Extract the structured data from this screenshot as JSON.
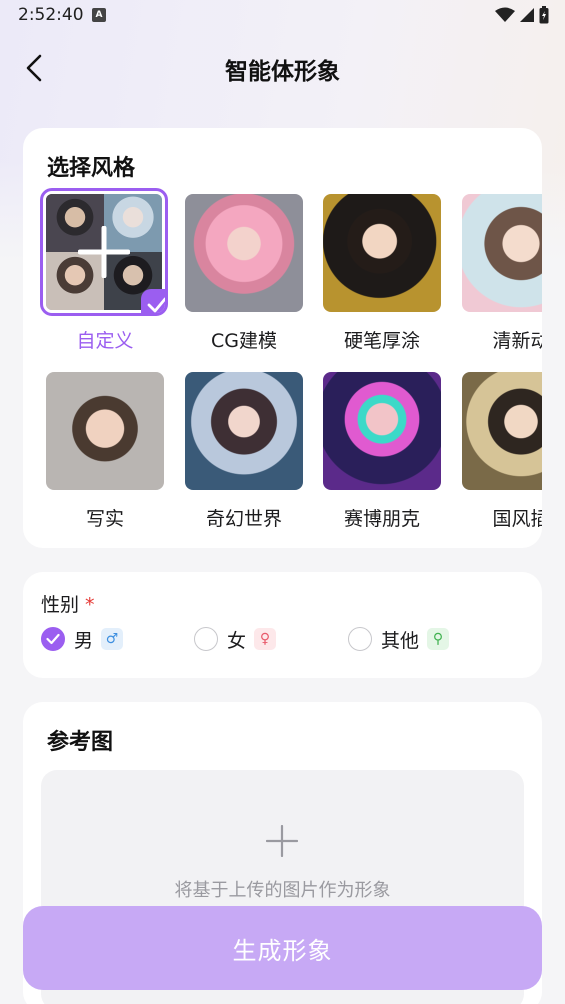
{
  "status_bar": {
    "time": "2:52:40",
    "notification_icon": "A"
  },
  "header": {
    "title": "智能体形象",
    "back_icon": "chevron-left-icon"
  },
  "style_section": {
    "title": "选择风格",
    "selected_index": 0,
    "items": [
      {
        "label": "自定义",
        "selected": true
      },
      {
        "label": "CG建模",
        "selected": false
      },
      {
        "label": "硬笔厚涂",
        "selected": false
      },
      {
        "label": "清新动",
        "selected": false
      },
      {
        "label": "写实",
        "selected": false
      },
      {
        "label": "奇幻世界",
        "selected": false
      },
      {
        "label": "赛博朋克",
        "selected": false
      },
      {
        "label": "国风插",
        "selected": false
      }
    ]
  },
  "gender_section": {
    "label": "性别",
    "required_mark": "*",
    "options": [
      {
        "label": "男",
        "icon_text": "♂",
        "checked": true
      },
      {
        "label": "女",
        "icon_text": "♀",
        "checked": false
      },
      {
        "label": "其他",
        "icon_text": "⚲",
        "checked": false
      }
    ]
  },
  "reference_section": {
    "title": "参考图",
    "upload_hint": "将基于上传的图片作为形象"
  },
  "generate_button": {
    "label": "生成形象"
  },
  "colors": {
    "accent": "#9b5ef0",
    "button_disabled": "#c7a9f5"
  }
}
